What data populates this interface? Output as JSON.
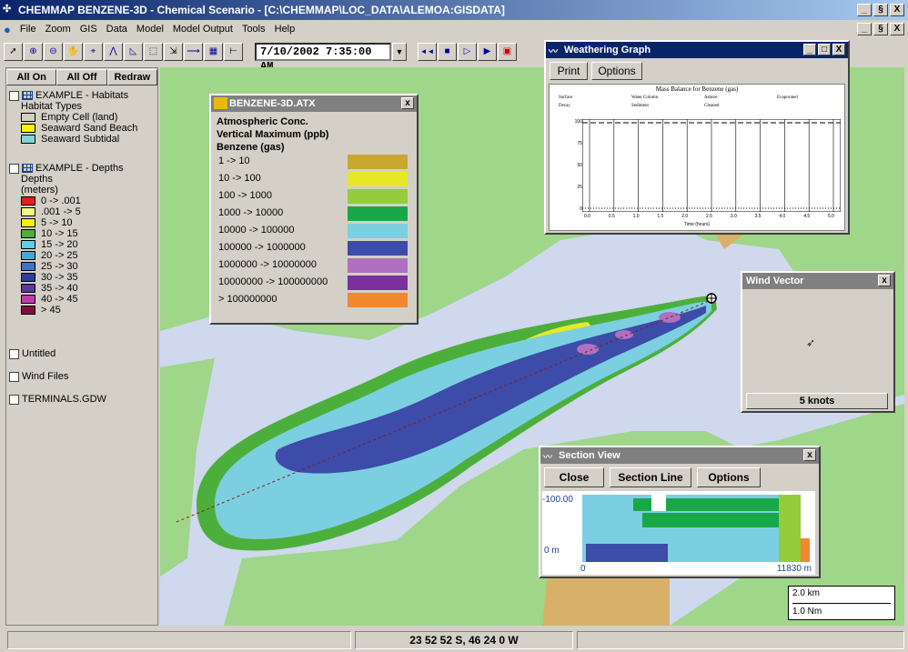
{
  "window": {
    "title": "CHEMMAP BENZENE-3D - Chemical Scenario - [C:\\CHEMMAP\\LOC_DATA\\ALEMOA:GISDATA]",
    "min_label": "_",
    "restore_label": "§",
    "close_label": "X"
  },
  "menu": [
    "File",
    "Zoom",
    "GIS",
    "Data",
    "Model",
    "Model Output",
    "Tools",
    "Help"
  ],
  "toolbar": {
    "datetime": "7/10/2002 7:35:00 AM",
    "dropdown_arrow": "▼",
    "icons": [
      "pointer-icon",
      "zoom-in-icon",
      "zoom-out-icon",
      "pan-icon",
      "measure-icon",
      "polyline-icon",
      "polygon-icon",
      "select-icon",
      "move-icon",
      "arrow-icon",
      "grid-icon",
      "ruler-icon"
    ],
    "playback": [
      "◄◄",
      "■",
      "▷",
      "▶"
    ]
  },
  "legend": {
    "buttons": [
      "All On",
      "All Off",
      "Redraw"
    ],
    "habitats": {
      "title": "EXAMPLE - Habitats",
      "subtitle": "Habitat Types",
      "items": [
        {
          "label": "Empty Cell (land)",
          "color": "#d4d0c8"
        },
        {
          "label": "Seaward Sand Beach",
          "color": "#f5f500"
        },
        {
          "label": "Seaward Subtidal",
          "color": "#80d6d6"
        }
      ]
    },
    "depths": {
      "title": "EXAMPLE - Depths",
      "subtitle1": "Depths",
      "subtitle2": "(meters)",
      "items": [
        {
          "label": "0 -> .001",
          "color": "#e81c1c"
        },
        {
          "label": ".001 -> 5",
          "color": "#f5f58a"
        },
        {
          "label": "5 -> 10",
          "color": "#f5f500"
        },
        {
          "label": "10 -> 15",
          "color": "#4caf3c"
        },
        {
          "label": "15 -> 20",
          "color": "#5ed0e0"
        },
        {
          "label": "20 -> 25",
          "color": "#4aa7d0"
        },
        {
          "label": "25 -> 30",
          "color": "#3a77c0"
        },
        {
          "label": "30 -> 35",
          "color": "#2c3f9c"
        },
        {
          "label": "35 -> 40",
          "color": "#5a3b9c"
        },
        {
          "label": "40 -> 45",
          "color": "#c03ca8"
        },
        {
          "label": "> 45",
          "color": "#801040"
        }
      ]
    },
    "layers": [
      "Untitled",
      "Wind Files",
      "TERMINALS.GDW"
    ]
  },
  "atx": {
    "title": "BENZENE-3D.ATX",
    "heading1": "Atmospheric Conc.",
    "heading2": "Vertical Maximum (ppb)",
    "heading3": "Benzene (gas)",
    "ranges": [
      {
        "label": "1 -> 10",
        "color": "#c8a832"
      },
      {
        "label": "10 -> 100",
        "color": "#e8e828"
      },
      {
        "label": "100 -> 1000",
        "color": "#94cc3c"
      },
      {
        "label": "1000 -> 10000",
        "color": "#18a848"
      },
      {
        "label": "10000 -> 100000",
        "color": "#7ccfe0"
      },
      {
        "label": "100000 -> 1000000",
        "color": "#3c4ca8"
      },
      {
        "label": "1000000 -> 10000000",
        "color": "#b070c0"
      },
      {
        "label": "10000000 -> 100000000",
        "color": "#7c30a0"
      },
      {
        "label": "> 100000000",
        "color": "#f08830"
      }
    ]
  },
  "weathering": {
    "title": "Weathering Graph",
    "print": "Print",
    "options": "Options",
    "chart_title": "Mass Balance for Benzene (gas)",
    "legend": [
      "Surface",
      "Water Column",
      "Ashore",
      "Evaporated",
      "Decay",
      "Sediment",
      "Cleaned"
    ],
    "yticks": [
      "100",
      "75",
      "50",
      "25",
      "0"
    ],
    "xticks": [
      "0.0",
      "0.5",
      "1.0",
      "1.5",
      "2.0",
      "2.5",
      "3.0",
      "3.5",
      "4.0",
      "4.5",
      "5.0"
    ],
    "xlabel": "Time (hours)"
  },
  "wind": {
    "title": "Wind Vector",
    "speed": "5 knots"
  },
  "section": {
    "title": "Section View",
    "close": "Close",
    "section_line": "Section Line",
    "options": "Options",
    "ytop": "-100.00",
    "ybottom": "0 m",
    "xleft": "0",
    "xright": "11830 m"
  },
  "scalebar": {
    "km": "2.0 km",
    "nm": "1.0 Nm"
  },
  "status": {
    "coords": "23  52  52 S,  46  24  0 W"
  },
  "colors": {
    "water": "#cfd8ec",
    "land": "#9fd68a",
    "land_orange": "#d8b06a"
  }
}
